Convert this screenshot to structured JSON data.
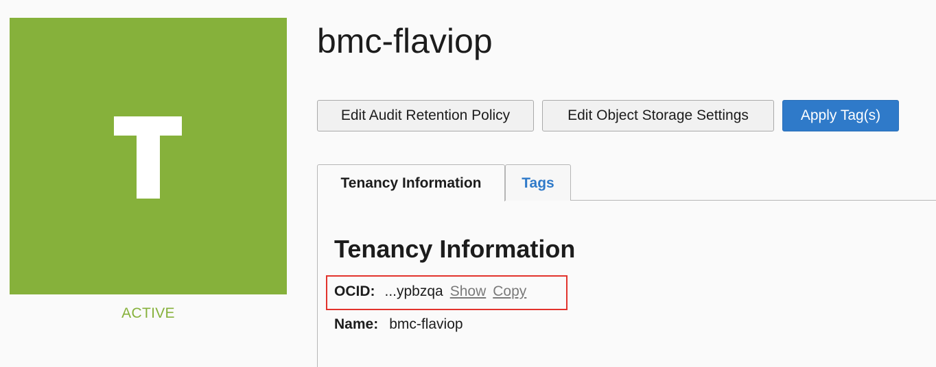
{
  "tile": {
    "letter": "T",
    "background_color": "#86b13b",
    "status": "ACTIVE",
    "status_color": "#86b13b"
  },
  "page": {
    "title": "bmc-flaviop"
  },
  "toolbar": {
    "edit_audit_label": "Edit Audit Retention Policy",
    "edit_storage_label": "Edit Object Storage Settings",
    "apply_tags_label": "Apply Tag(s)",
    "primary_color": "#2f7ac9"
  },
  "tabs": [
    {
      "label": "Tenancy Information",
      "active": true
    },
    {
      "label": "Tags",
      "active": false
    }
  ],
  "tenancy": {
    "heading": "Tenancy Information",
    "ocid_label": "OCID:",
    "ocid_value": "...ypbzqa",
    "show_label": "Show",
    "copy_label": "Copy",
    "name_label": "Name:",
    "name_value": "bmc-flaviop",
    "highlight_color": "#e2322b"
  }
}
